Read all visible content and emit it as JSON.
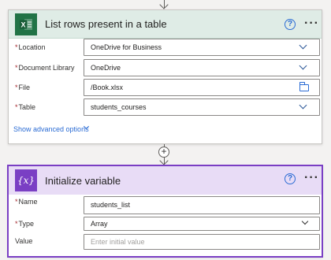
{
  "actions": [
    {
      "title": "List rows present in a table",
      "fields": [
        {
          "label": "Location",
          "required": "*",
          "value": "OneDrive for Business"
        },
        {
          "label": "Document Library",
          "required": "*",
          "value": "OneDrive"
        },
        {
          "label": "File",
          "required": "*",
          "value": "/Book.xlsx"
        },
        {
          "label": "Table",
          "required": "*",
          "value": "students_courses"
        }
      ],
      "advanced_link": "Show advanced options",
      "help_glyph": "?",
      "more_glyph": "···"
    },
    {
      "title": "Initialize variable",
      "icon_text": "{x}",
      "fields": [
        {
          "label": "Name",
          "required": "*",
          "value": "students_list"
        },
        {
          "label": "Type",
          "required": "*",
          "value": "Array"
        },
        {
          "label": "Value",
          "placeholder": "Enter initial value"
        }
      ],
      "help_glyph": "?",
      "more_glyph": "···"
    }
  ],
  "insert_step_glyph": "+",
  "colors": {
    "excel_green": "#217346",
    "variable_purple": "#7a3fc4",
    "link_blue": "#2b6cd4",
    "required_red": "#a4262c"
  },
  "icons": [
    "excel-icon",
    "variable-icon",
    "help-icon",
    "more-options-icon",
    "chevron-down-icon",
    "folder-icon",
    "plus-icon"
  ]
}
